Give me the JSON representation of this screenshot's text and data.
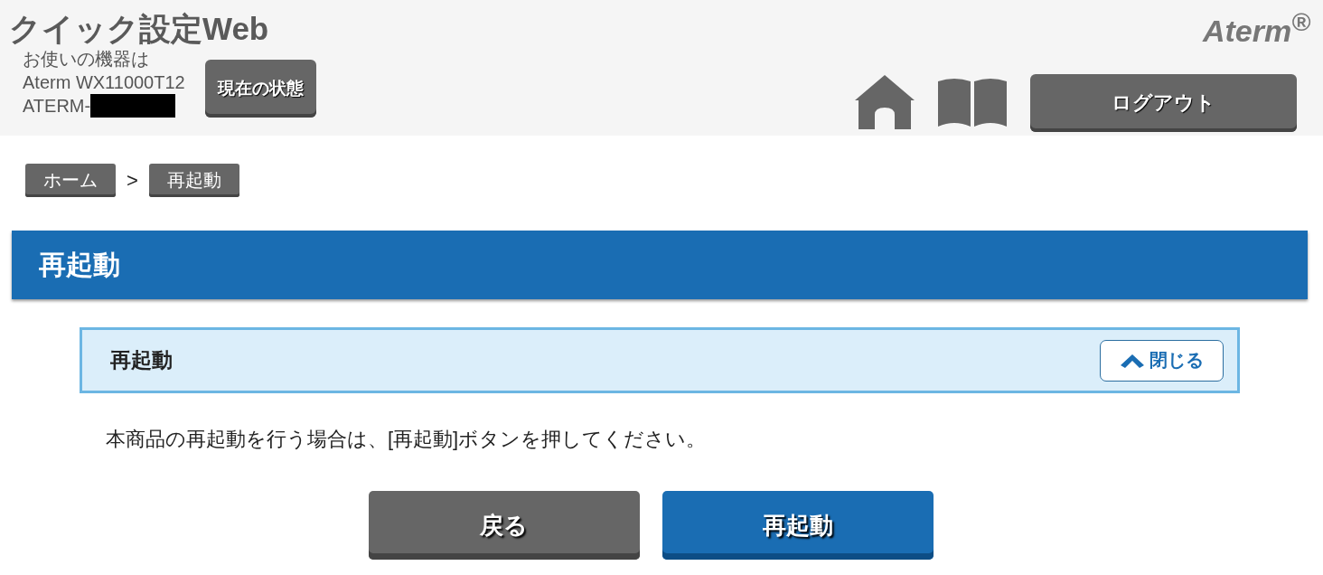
{
  "header": {
    "title": "クイック設定Web",
    "device_label": "お使いの機器は",
    "device_model": "Aterm WX11000T12",
    "device_id": "ATERM-",
    "device_id_redacted": true,
    "status_button": "現在の状態",
    "logo": "Aterm$^{®}$",
    "logout_button": "ログアウト"
  },
  "breadcrumb": {
    "items": [
      {
        "label": "ホーム"
      },
      {
        "label": "再起動"
      }
    ],
    "separator": ">"
  },
  "page_title": "再起動",
  "section": {
    "title": "再起動",
    "toggle_label": "閉じる",
    "expanded": true
  },
  "message": "本商品の再起動を行う場合は、[再起動]ボタンを押してください。",
  "buttons": [
    {
      "label": "戻る",
      "kind": "secondary"
    },
    {
      "label": "再起動",
      "kind": "primary"
    }
  ]
}
